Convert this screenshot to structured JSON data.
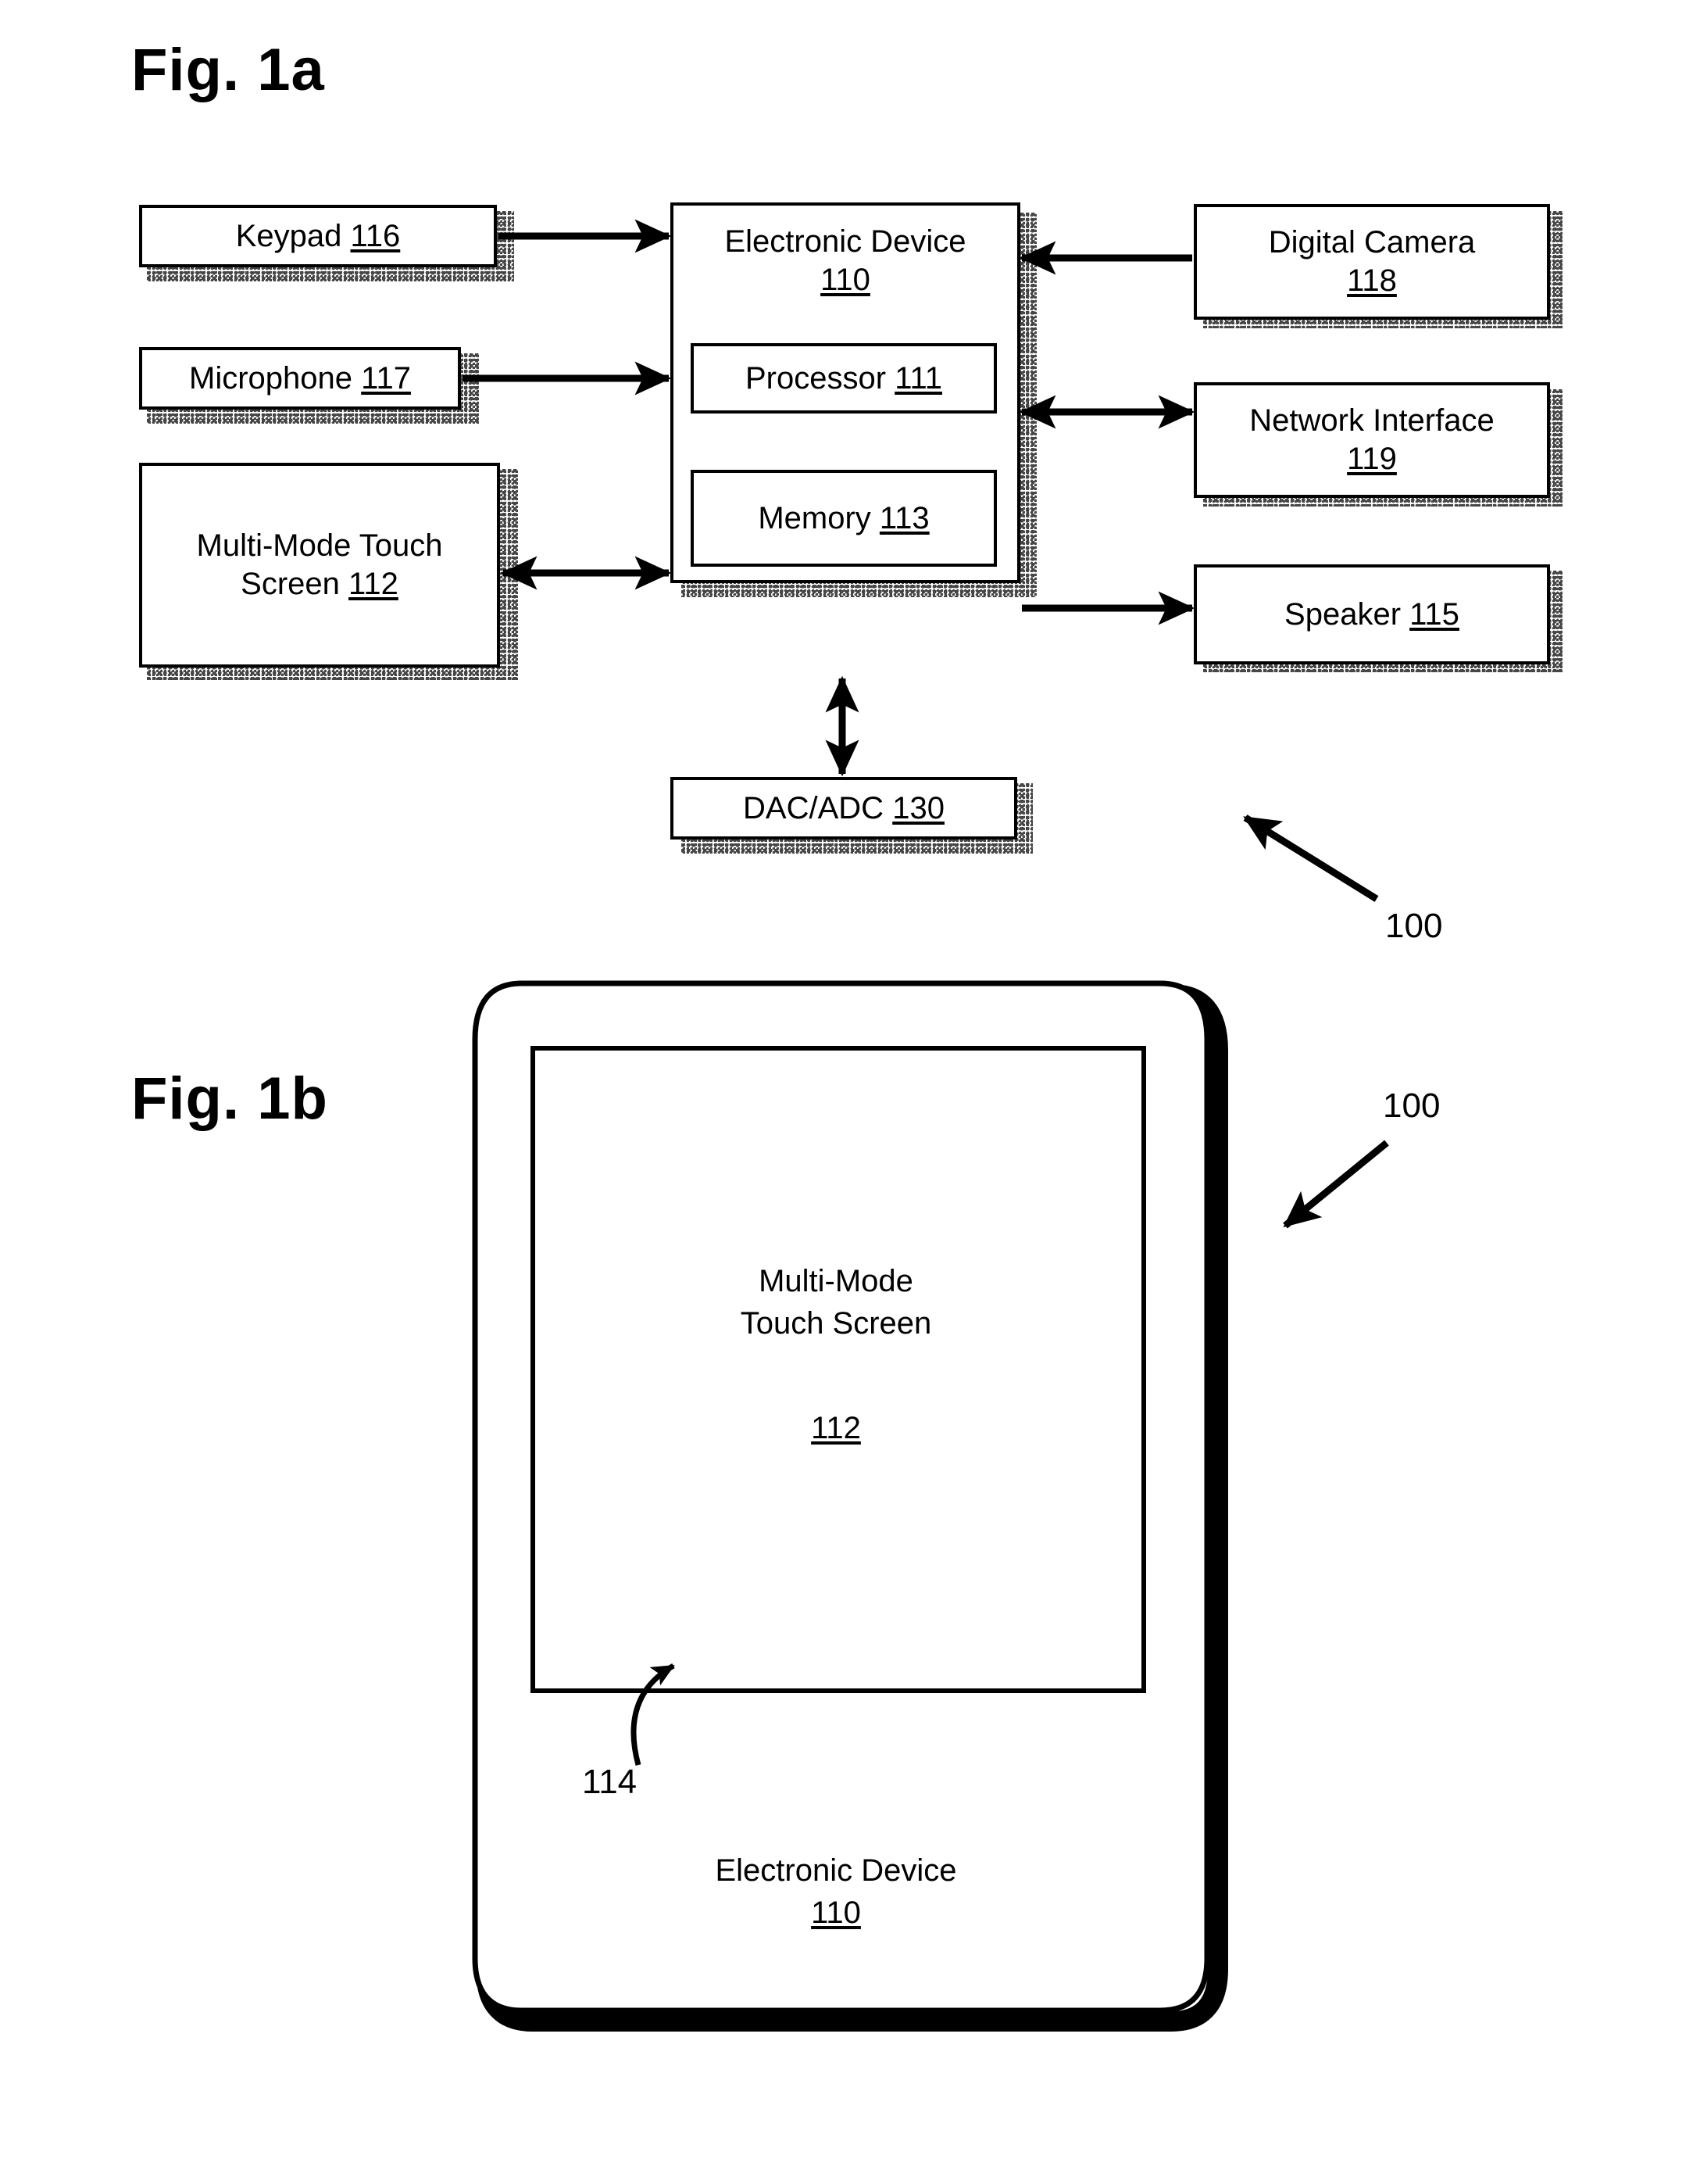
{
  "figures": {
    "fig_a_caption": "Fig. 1a",
    "fig_b_caption": "Fig. 1b"
  },
  "fig_1a": {
    "blocks": {
      "keypad": {
        "title": "Keypad",
        "ref": "116"
      },
      "microphone": {
        "title": "Microphone",
        "ref": "117"
      },
      "touch_screen": {
        "title_line1": "Multi-Mode Touch",
        "title_line2": "Screen",
        "ref": "112"
      },
      "electronic_device": {
        "title": "Electronic  Device",
        "ref": "110"
      },
      "processor": {
        "title": "Processor",
        "ref": "111"
      },
      "memory": {
        "title": "Memory",
        "ref": "113"
      },
      "dac_adc": {
        "title": "DAC/ADC",
        "ref": "130"
      },
      "digital_camera": {
        "title": "Digital Camera",
        "ref": "118"
      },
      "network_interface": {
        "title": "Network Interface",
        "ref": "119"
      },
      "speaker": {
        "title": "Speaker",
        "ref": "115"
      }
    },
    "callouts": {
      "system_ref": "100"
    },
    "connections": [
      {
        "from": "keypad",
        "to": "electronic_device",
        "direction": "one-way"
      },
      {
        "from": "microphone",
        "to": "electronic_device",
        "direction": "one-way"
      },
      {
        "from": "touch_screen",
        "to": "electronic_device",
        "direction": "two-way"
      },
      {
        "from": "digital_camera",
        "to": "electronic_device",
        "direction": "one-way"
      },
      {
        "from": "electronic_device",
        "to": "network_interface",
        "direction": "two-way"
      },
      {
        "from": "electronic_device",
        "to": "speaker",
        "direction": "one-way"
      },
      {
        "from": "electronic_device",
        "to": "dac_adc",
        "direction": "two-way"
      }
    ]
  },
  "fig_1b": {
    "device": {
      "screen_line1": "Multi-Mode",
      "screen_line2": "Touch Screen",
      "screen_ref": "112",
      "body_label": "Electronic Device",
      "body_ref": "110"
    },
    "callouts": {
      "system_ref": "100",
      "screen_edge_ref": "114"
    }
  },
  "colors": {
    "ink": "#000000",
    "paper": "#ffffff"
  }
}
